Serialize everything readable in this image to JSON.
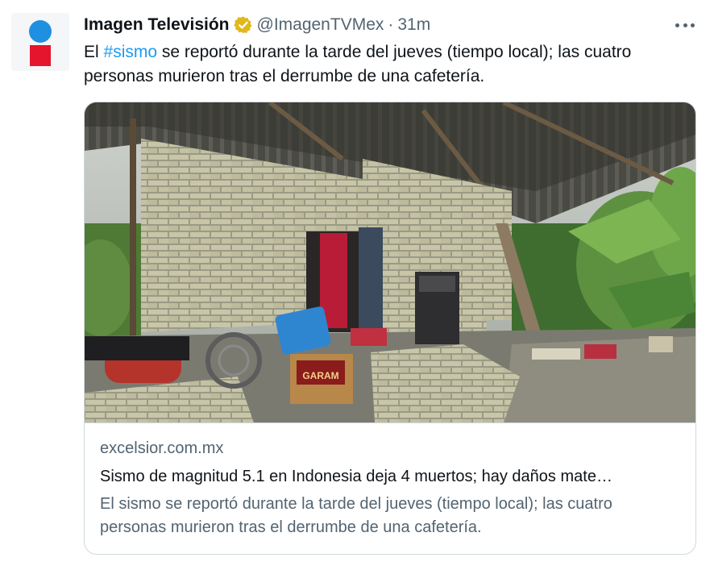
{
  "tweet": {
    "author_name": "Imagen Televisión",
    "handle": "@ImagenTVMex",
    "separator": "·",
    "time": "31m",
    "text_before": "El ",
    "hashtag": "#sismo",
    "text_after": " se reportó durante la tarde del jueves (tiempo local); las cuatro personas murieron tras el derrumbe de una cafetería.",
    "verified_icon": "verified-badge-icon",
    "more_icon": "more-options-icon"
  },
  "card": {
    "domain": "excelsior.com.mx",
    "title": "Sismo de magnitud 5.1 en Indonesia deja 4 muertos; hay daños mate…",
    "description": "El sismo se reportó durante la tarde del jueves (tiempo local); las cuatro personas murieron tras el derrumbe de una cafetería.",
    "box_text": "GARAM"
  },
  "colors": {
    "link_blue": "#1d9bf0",
    "verified_gold": "#e2b719",
    "secondary_text": "#536471",
    "border": "#cfd9de"
  }
}
